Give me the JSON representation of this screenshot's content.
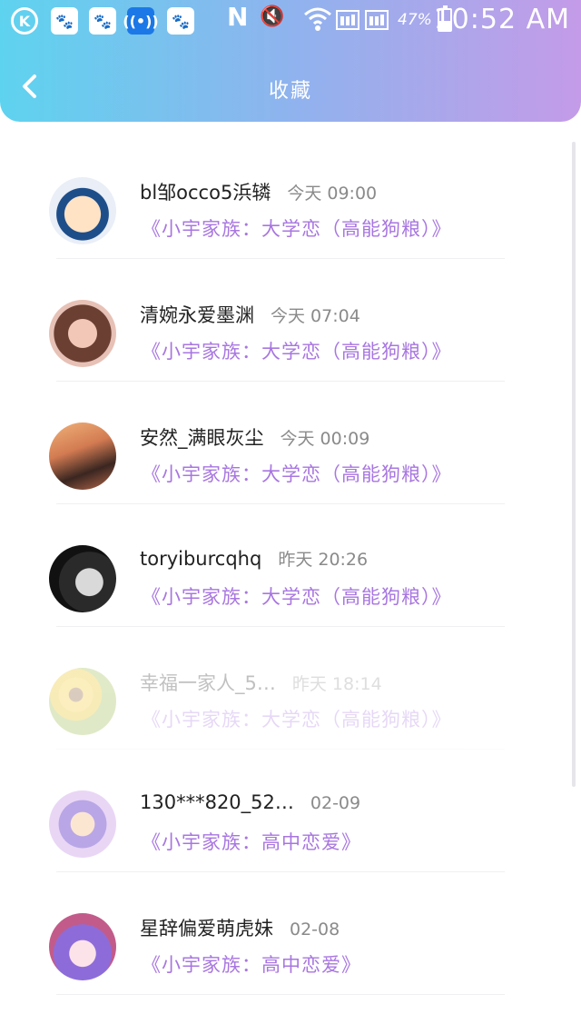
{
  "status_bar": {
    "time": "10:52 AM",
    "battery_percent": "47%",
    "battery_level": 0.47,
    "left_icons": [
      "k-circle-icon",
      "baidu-paw-icon",
      "baidu-paw-icon",
      "wifi-hotspot-icon",
      "baidu-paw-icon"
    ],
    "n_label": "N"
  },
  "header": {
    "title": "收藏",
    "back_label": "‹"
  },
  "items": [
    {
      "name": "bl邹occo5浜辚",
      "time": "今天 09:00",
      "collection": "《小宇家族：大学恋（高能狗粮）》",
      "faded": false,
      "avatar": "cartoon-official-avatar"
    },
    {
      "name": "清婉永爱墨渊",
      "time": "今天 07:04",
      "collection": "《小宇家族：大学恋（高能狗粮）》",
      "faded": false,
      "avatar": "girl-glasses-avatar"
    },
    {
      "name": "安然_满眼灰尘",
      "time": "今天 00:09",
      "collection": "《小宇家族：大学恋（高能狗粮）》",
      "faded": false,
      "avatar": "girl-sunset-avatar"
    },
    {
      "name": "toryiburcqhq",
      "time": "昨天 20:26",
      "collection": "《小宇家族：大学恋（高能狗粮）》",
      "faded": false,
      "avatar": "bw-man-avatar"
    },
    {
      "name": "幸福一家人_5…",
      "time": "昨天 18:14",
      "collection": "《小宇家族：大学恋（高能狗粮）》",
      "faded": true,
      "avatar": "sunflower-avatar"
    },
    {
      "name": "130***820_52…",
      "time": "02-09",
      "collection": "《小宇家族：高中恋爱》",
      "faded": false,
      "avatar": "anime-bunny-avatar"
    },
    {
      "name": "星辞偏爱萌虎妹",
      "time": "02-08",
      "collection": "《小宇家族：高中恋爱》",
      "faded": false,
      "avatar": "anime-purple-avatar"
    }
  ],
  "colors": {
    "header_gradient_start": "#5ed3ef",
    "header_gradient_end": "#c49be8",
    "collection_text": "#a876e0"
  }
}
